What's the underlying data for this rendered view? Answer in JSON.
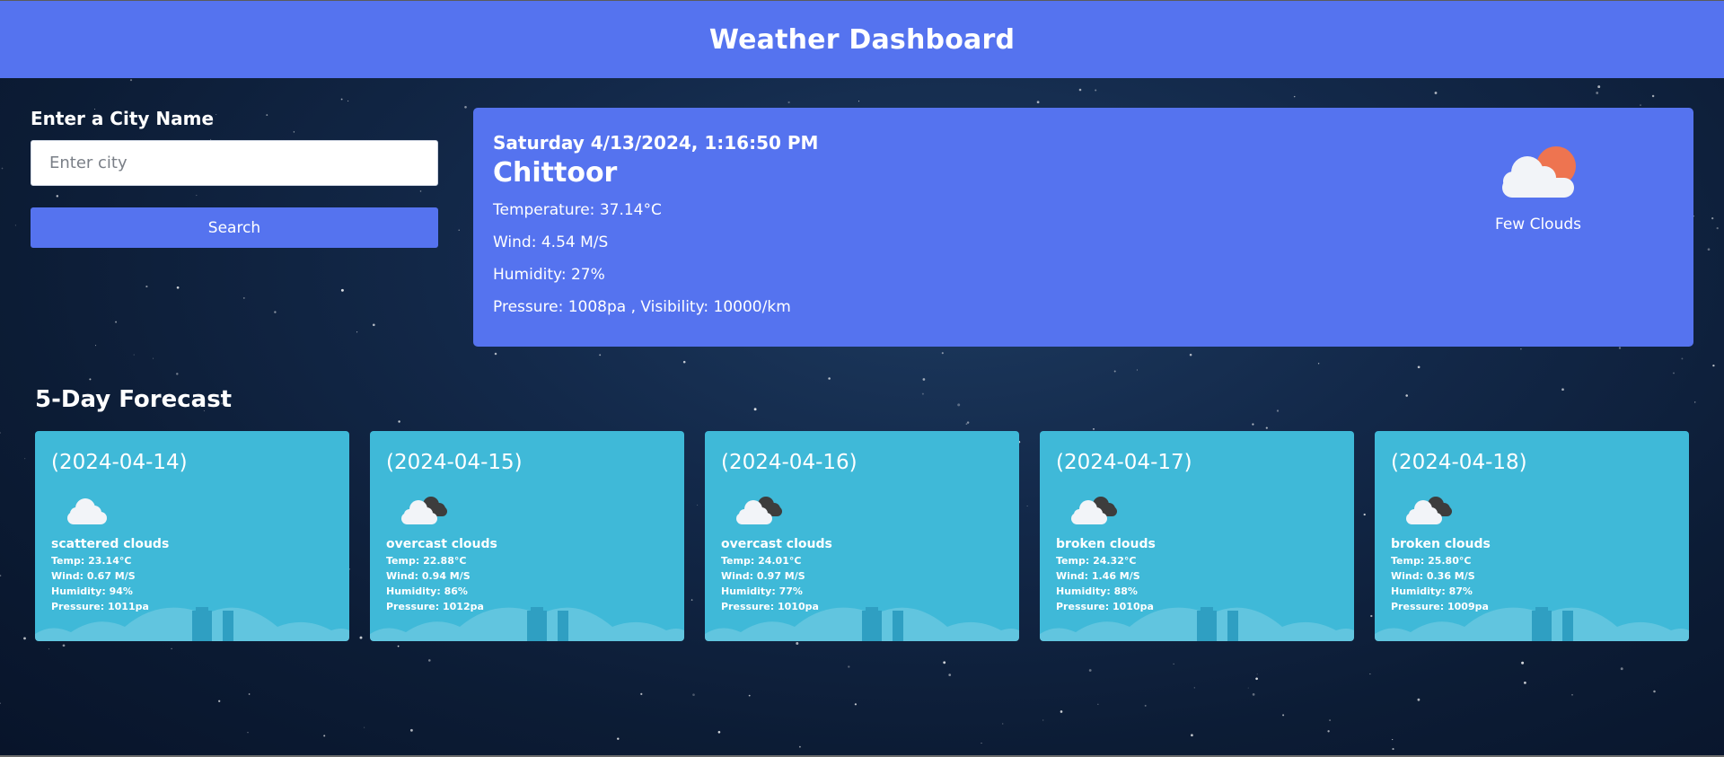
{
  "header": {
    "title": "Weather Dashboard"
  },
  "search": {
    "label": "Enter a City Name",
    "placeholder": "Enter city",
    "value": "",
    "button_label": "Search"
  },
  "current": {
    "datetime": "Saturday 4/13/2024, 1:16:50 PM",
    "city": "Chittoor",
    "temperature": "Temperature: 37.14°C",
    "wind": "Wind: 4.54 M/S",
    "humidity": "Humidity: 27%",
    "pressure_visibility": "Pressure: 1008pa , Visibility: 10000/km",
    "icon": "few-clouds-day-icon",
    "description": "Few Clouds"
  },
  "forecast": {
    "title": "5-Day Forecast",
    "days": [
      {
        "date": "(2024-04-14)",
        "icon": "scattered-clouds-icon",
        "description": "scattered clouds",
        "temp": "Temp: 23.14°C",
        "wind": "Wind: 0.67 M/S",
        "humidity": "Humidity: 94%",
        "pressure": "Pressure: 1011pa"
      },
      {
        "date": "(2024-04-15)",
        "icon": "overcast-clouds-icon",
        "description": "overcast clouds",
        "temp": "Temp: 22.88°C",
        "wind": "Wind: 0.94 M/S",
        "humidity": "Humidity: 86%",
        "pressure": "Pressure: 1012pa"
      },
      {
        "date": "(2024-04-16)",
        "icon": "overcast-clouds-icon",
        "description": "overcast clouds",
        "temp": "Temp: 24.01°C",
        "wind": "Wind: 0.97 M/S",
        "humidity": "Humidity: 77%",
        "pressure": "Pressure: 1010pa"
      },
      {
        "date": "(2024-04-17)",
        "icon": "broken-clouds-icon",
        "description": "broken clouds",
        "temp": "Temp: 24.32°C",
        "wind": "Wind: 1.46 M/S",
        "humidity": "Humidity: 88%",
        "pressure": "Pressure: 1010pa"
      },
      {
        "date": "(2024-04-18)",
        "icon": "broken-clouds-icon",
        "description": "broken clouds",
        "temp": "Temp: 25.80°C",
        "wind": "Wind: 0.36 M/S",
        "humidity": "Humidity: 87%",
        "pressure": "Pressure: 1009pa"
      }
    ]
  },
  "colors": {
    "header_bg": "#5573ef",
    "current_card_bg": "#5573ef",
    "forecast_card_bg": "#3fb9d8",
    "sun": "#ee7450",
    "cloud_light": "#f2f4f8",
    "cloud_dark": "#3d3d3d",
    "page_bg": "#13294a"
  }
}
